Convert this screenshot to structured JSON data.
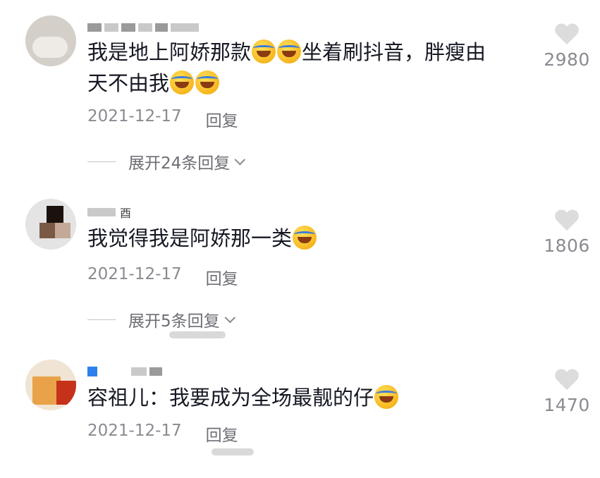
{
  "comments": [
    {
      "username": "",
      "text_parts": [
        "我是地上阿娇那款",
        "坐着刷抖音，胖瘦由",
        "天不由我"
      ],
      "emojis": [
        "laughing-crying-emoji",
        "laughing-crying-emoji",
        "crying-emoji",
        "crying-emoji"
      ],
      "date": "2021-12-17",
      "reply_label": "回复",
      "expand_label": "展开24条回复",
      "likes": "2980"
    },
    {
      "username": "酉",
      "text_parts": [
        "我觉得我是阿娇那一类"
      ],
      "emojis": [
        "laughing-crying-emoji"
      ],
      "date": "2021-12-17",
      "reply_label": "回复",
      "expand_label": "展开5条回复",
      "likes": "1806"
    },
    {
      "username": "",
      "text_parts": [
        "容祖儿：我要成为全场最靓的仔"
      ],
      "emojis": [
        "laughing-crying-emoji"
      ],
      "date": "2021-12-17",
      "reply_label": "回复",
      "likes": "1470"
    }
  ],
  "colors": {
    "text": "#161823",
    "meta": "#8a8b91",
    "heart": "#dcdcdc"
  }
}
